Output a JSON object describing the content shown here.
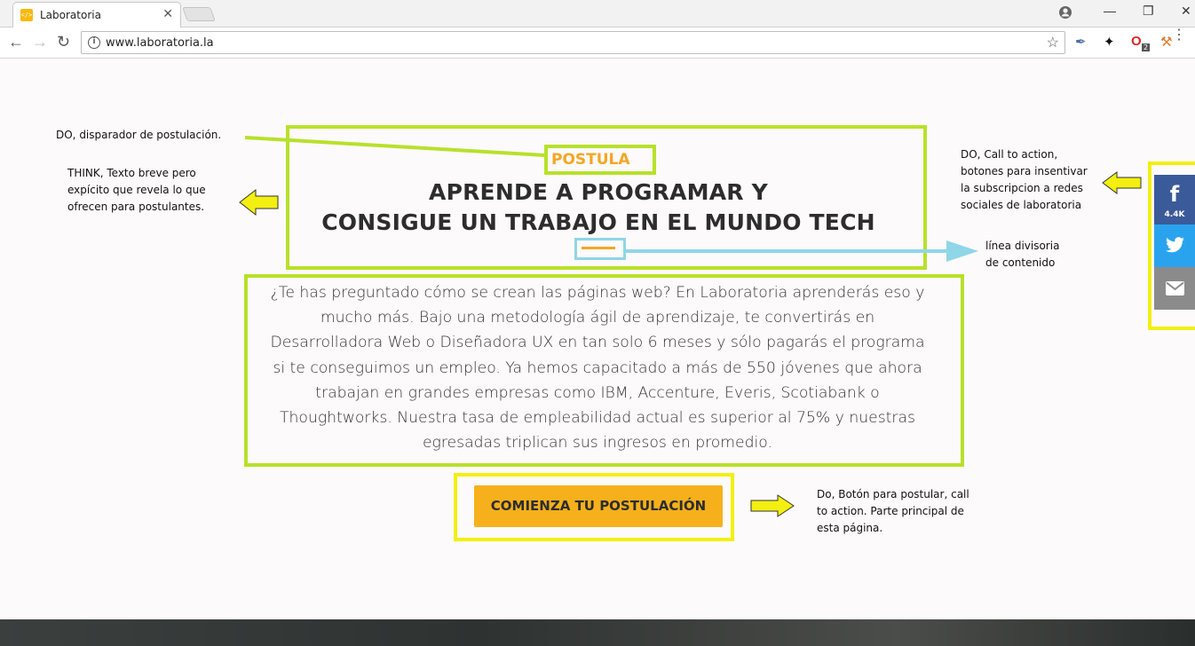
{
  "browser": {
    "tab_title": "Laboratoria",
    "tab_favicon_text": "</>",
    "tab_close": "✕",
    "url": "www.laboratoria.la",
    "window_controls": {
      "minimize": "—",
      "restore": "❐",
      "close": "✕"
    },
    "extension_badge": "2"
  },
  "hero": {
    "postula_label": "POSTULA",
    "headline_line1": "APRENDE A PROGRAMAR Y",
    "headline_line2": "CONSIGUE UN TRABAJO EN EL MUNDO TECH",
    "body_lines": [
      "¿Te has preguntado cómo se crean las páginas web? En Laboratoria aprenderás eso y",
      "mucho más. Bajo una metodología ágil de aprendizaje, te convertirás en",
      "Desarrolladora Web o Diseñadora UX en tan solo 6 meses y sólo pagarás el programa",
      "si te conseguimos un empleo. Ya hemos capacitado a más de 550 jóvenes que ahora",
      "trabajan en grandes empresas como IBM, Accenture, Everis, Scotiabank o",
      "Thoughtworks. Nuestra tasa de empleabilidad actual es superior al 75% y nuestras",
      "egresadas triplican sus ingresos en promedio."
    ],
    "cta_label": "COMIENZA TU POSTULACIÓN"
  },
  "social": {
    "facebook_glyph": "f",
    "facebook_count": "4.4K",
    "twitter_glyph": "🐦",
    "email_glyph": "✉"
  },
  "annotations": {
    "note_do_trigger": "DO, disparador de postulación.",
    "note_think_lines": [
      "THINK, Texto breve pero",
      "expícito que revela lo que",
      "ofrecen para postulantes."
    ],
    "note_cta_social_lines": [
      "DO, Call to action,",
      "botones para insentivar",
      "la subscripcion a redes",
      "sociales de laboratoria"
    ],
    "note_divider_lines": [
      "línea divisoria",
      "de contenido"
    ],
    "note_button_lines": [
      "Do, Botón para postular, call",
      "to action. Parte principal de",
      "esta página."
    ]
  },
  "colors": {
    "accent": "#f5a623",
    "annotation_green": "#b7e12a",
    "annotation_yellow": "#f3ef10",
    "annotation_blue": "#8fd6e8",
    "facebook": "#3b5a99",
    "twitter": "#2aa3ef",
    "email": "#8b8b8b"
  }
}
